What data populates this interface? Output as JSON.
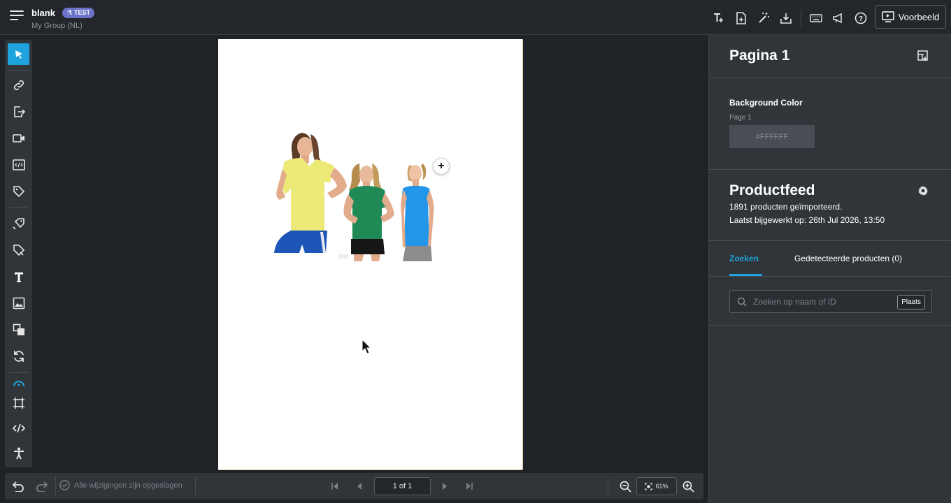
{
  "header": {
    "title": "blank",
    "badge": "TEST",
    "subtitle": "My Group (NL)",
    "preview_label": "Voorbeeld",
    "icons": [
      "text-style-icon",
      "add-page-icon",
      "magic-wand-icon",
      "download-icon",
      "keyboard-icon",
      "megaphone-icon",
      "help-icon"
    ]
  },
  "left_toolbar": {
    "tools": [
      "select-tool-icon",
      "link-icon",
      "export-icon",
      "video-icon",
      "embed-icon",
      "tag-icon",
      "product-tag-icon",
      "product-edit-icon",
      "text-icon",
      "image-icon",
      "shapes-icon",
      "refresh-icon",
      "gauge-icon",
      "crop-icon",
      "code-icon",
      "accessibility-icon"
    ]
  },
  "bottom_bar": {
    "saved_text": "Alle wijzigingen zijn opgeslagen",
    "page_indicator": "1 of 1",
    "zoom": "61%"
  },
  "right_panel": {
    "page_title": "Pagina 1",
    "background_label": "Background Color",
    "page_label": "Page 1",
    "color_value": "#FFFFFF",
    "feed_title": "Productfeed",
    "feed_count": "1891 producten geïmporteerd.",
    "feed_updated": "Laatst bijgewerkt op: 26th Jul 2026, 13:50",
    "tabs": [
      {
        "label": "Zoeken",
        "active": true
      },
      {
        "label": "Gedetecteerde producten (0)",
        "active": false
      }
    ],
    "search_placeholder": "Zoeken op naam of ID",
    "place_button": "Plaats"
  },
  "colors": {
    "accent": "#1ea3dc",
    "badge": "#6b74c9",
    "panel": "#30353a",
    "background": "#1f2327"
  }
}
